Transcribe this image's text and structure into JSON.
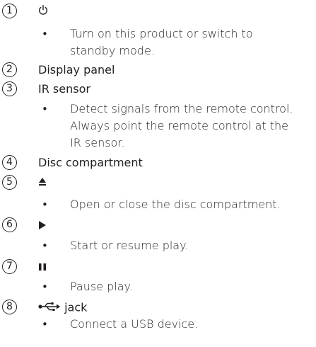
{
  "items": [
    {
      "num": "1",
      "title_icon": "power-icon",
      "desc": "Turn on this product or switch to standby mode."
    },
    {
      "num": "2",
      "title": "Display panel"
    },
    {
      "num": "3",
      "title": "IR sensor",
      "desc_lines": [
        "Detect signals from the remote control.",
        "Always point the remote control at the",
        "IR sensor."
      ]
    },
    {
      "num": "4",
      "title": "Disc compartment"
    },
    {
      "num": "5",
      "title_icon": "eject-icon",
      "desc": "Open or close the disc compartment."
    },
    {
      "num": "6",
      "title_icon": "play-icon",
      "desc": "Start or resume play."
    },
    {
      "num": "7",
      "title_icon": "pause-icon",
      "desc": "Pause play."
    },
    {
      "num": "8",
      "title_icon": "usb-icon",
      "title": "jack",
      "desc": "Connect a USB device."
    }
  ],
  "item1": {
    "desc_line1": "Turn on this product or switch to",
    "desc_line2": "standby mode."
  }
}
